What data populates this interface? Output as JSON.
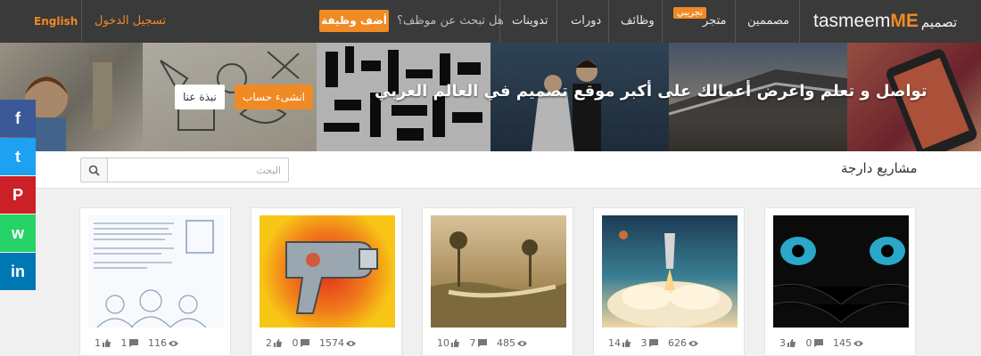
{
  "nav": {
    "logo_latin": "tasmeem",
    "logo_me": "ME",
    "logo_arabic": "تصميم",
    "designers": "مصممين",
    "store": "متجر",
    "store_badge": "تجريبي",
    "jobs": "وظائف",
    "courses": "دورات",
    "blogs": "تدوينات",
    "hire_question": "هل تبحث عن موظف؟",
    "post_job": "أضف وظيفة",
    "login": "تسجيل الدخول",
    "language": "English"
  },
  "hero": {
    "title": "تواصل و تعلم واعرض أعمالك على أكبر موقع تصميم في العالم العربي",
    "signup": "انشىء حساب",
    "about": "نبذة عنا"
  },
  "social": [
    {
      "icon": "facebook-icon",
      "glyph": "f",
      "color": "#3b5998"
    },
    {
      "icon": "twitter-icon",
      "glyph": "t",
      "color": "#1da1f2"
    },
    {
      "icon": "pinterest-icon",
      "glyph": "P",
      "color": "#cb2027"
    },
    {
      "icon": "whatsapp-icon",
      "glyph": "w",
      "color": "#25d366"
    },
    {
      "icon": "linkedin-icon",
      "glyph": "in",
      "color": "#0077b5"
    }
  ],
  "trending": {
    "title": "مشاريع دارجة",
    "search_placeholder": "البحث"
  },
  "projects": [
    {
      "likes": "3",
      "comments": "0",
      "views": "145"
    },
    {
      "likes": "14",
      "comments": "3",
      "views": "626"
    },
    {
      "likes": "10",
      "comments": "7",
      "views": "485"
    },
    {
      "likes": "2",
      "comments": "0",
      "views": "1574"
    },
    {
      "likes": "1",
      "comments": "1",
      "views": "116"
    }
  ],
  "colors": {
    "accent": "#f08a24",
    "nav_bg": "#3a3a3a"
  }
}
